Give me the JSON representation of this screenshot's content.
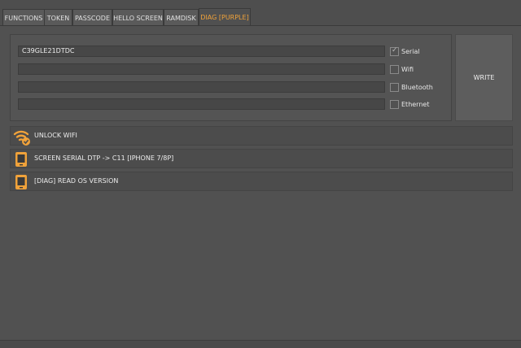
{
  "tabs": [
    {
      "label": "FUNCTIONS"
    },
    {
      "label": "TOKEN"
    },
    {
      "label": "PASSCODE"
    },
    {
      "label": "HELLO SCREEN"
    },
    {
      "label": "RAMDISK"
    },
    {
      "label": "DIAG [PURPLE]",
      "active": true
    }
  ],
  "fields": {
    "serial_value": "C39GLE21DTDC",
    "wifi_value": "",
    "bluetooth_value": "",
    "ethernet_value": ""
  },
  "checkboxes": {
    "serial": {
      "label": "Serial",
      "checked": true
    },
    "wifi": {
      "label": "Wifi",
      "checked": false
    },
    "bluetooth": {
      "label": "Bluetooth",
      "checked": false
    },
    "ethernet": {
      "label": "Ethernet",
      "checked": false
    }
  },
  "write_button": {
    "label": "WRITE"
  },
  "actions": [
    {
      "label": "UNLOCK WIFI",
      "icon": "wifi-check-icon"
    },
    {
      "label": "SCREEN SERIAL DTP -> C11 [IPHONE 7/8P]",
      "icon": "phone-icon"
    },
    {
      "label": "[DIAG] READ OS VERSION",
      "icon": "phone-icon"
    }
  ],
  "colors": {
    "accent": "#f0a23a",
    "background": "#535353"
  }
}
